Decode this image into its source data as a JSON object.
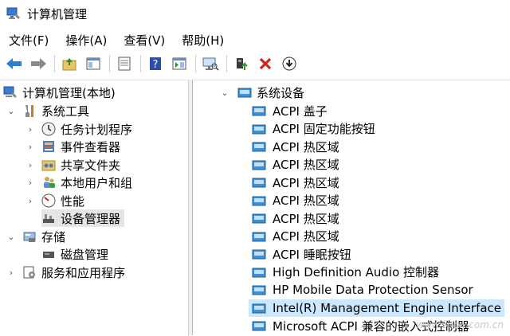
{
  "window": {
    "title": "计算机管理"
  },
  "menu": {
    "items": [
      "文件(F)",
      "操作(A)",
      "查看(V)",
      "帮助(H)"
    ]
  },
  "tree": {
    "root": "计算机管理(本地)",
    "system_tools": "系统工具",
    "task_scheduler": "任务计划程序",
    "event_viewer": "事件查看器",
    "shared_folders": "共享文件夹",
    "local_users": "本地用户和组",
    "performance": "性能",
    "device_manager": "设备管理器",
    "storage": "存储",
    "disk_management": "磁盘管理",
    "services_apps": "服务和应用程序"
  },
  "devices": {
    "category": "系统设备",
    "items": [
      "ACPI 盖子",
      "ACPI 固定功能按钮",
      "ACPI 热区域",
      "ACPI 热区域",
      "ACPI 热区域",
      "ACPI 热区域",
      "ACPI 热区域",
      "ACPI 热区域",
      "ACPI 睡眠按钮",
      "High Definition Audio 控制器",
      "HP Mobile Data Protection Sensor",
      "Intel(R) Management Engine Interface",
      "Microsoft ACPI 兼容的嵌入式控制器"
    ],
    "highlighted_index": 11
  },
  "watermark": "www.cpcw.com.cn",
  "colors": {
    "selection": "#cce8ff",
    "tree_selected": "#e5e5e5"
  }
}
